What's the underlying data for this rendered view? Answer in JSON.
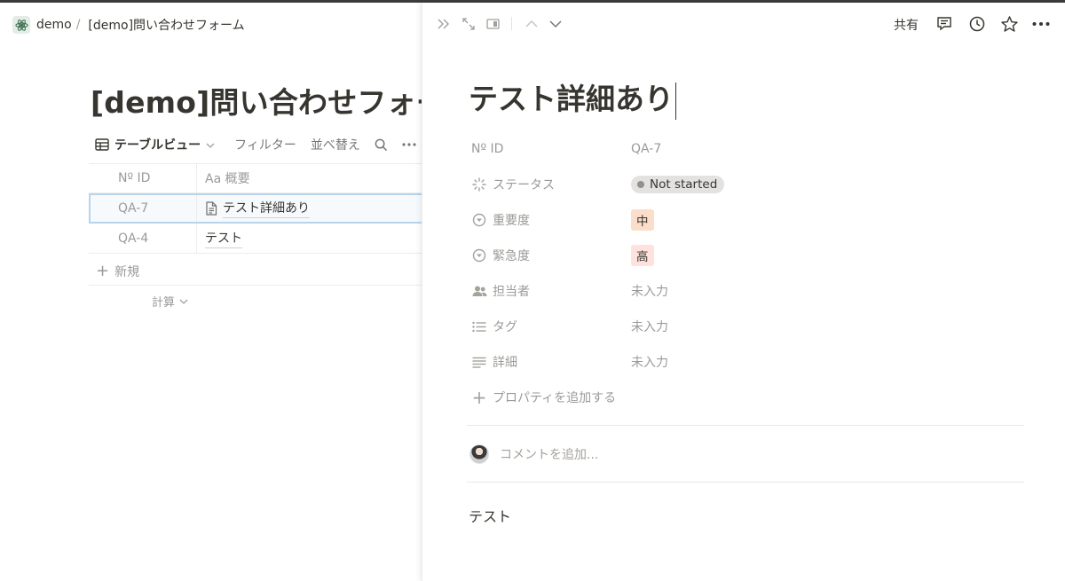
{
  "breadcrumb": {
    "workspace": "demo",
    "separator": "/",
    "page": "[demo]問い合わせフォーム"
  },
  "database": {
    "title": "[demo]問い合わせフォー",
    "view_label": "テーブルビュー",
    "filter_label": "フィルター",
    "sort_label": "並べ替え",
    "columns": {
      "id": "Nº ID",
      "summary": "Aa 概要"
    },
    "rows": [
      {
        "id": "QA-7",
        "summary": "テスト詳細あり"
      },
      {
        "id": "QA-4",
        "summary": "テスト"
      }
    ],
    "new_label": "新規",
    "calc_label": "計算"
  },
  "peek": {
    "share_label": "共有",
    "title": "テスト詳細あり",
    "properties": [
      {
        "icon": "id-icon",
        "label": "Nº ID",
        "value": "QA-7"
      },
      {
        "icon": "status-icon",
        "label": "ステータス",
        "value": "Not started"
      },
      {
        "icon": "select-icon",
        "label": "重要度",
        "value": "中"
      },
      {
        "icon": "select-icon",
        "label": "緊急度",
        "value": "高"
      },
      {
        "icon": "people-icon",
        "label": "担当者",
        "value": "未入力"
      },
      {
        "icon": "list-icon",
        "label": "タグ",
        "value": "未入力"
      },
      {
        "icon": "text-icon",
        "label": "詳細",
        "value": "未入力"
      }
    ],
    "add_property_label": "プロパティを追加する",
    "comment_placeholder": "コメントを追加...",
    "body_text": "テスト"
  },
  "colors": {
    "status_pill": "#e3e2e0",
    "importance_tag": "#fadec9",
    "urgency_tag": "#ffe2dd",
    "selection_outline": "#b8d4ec"
  }
}
